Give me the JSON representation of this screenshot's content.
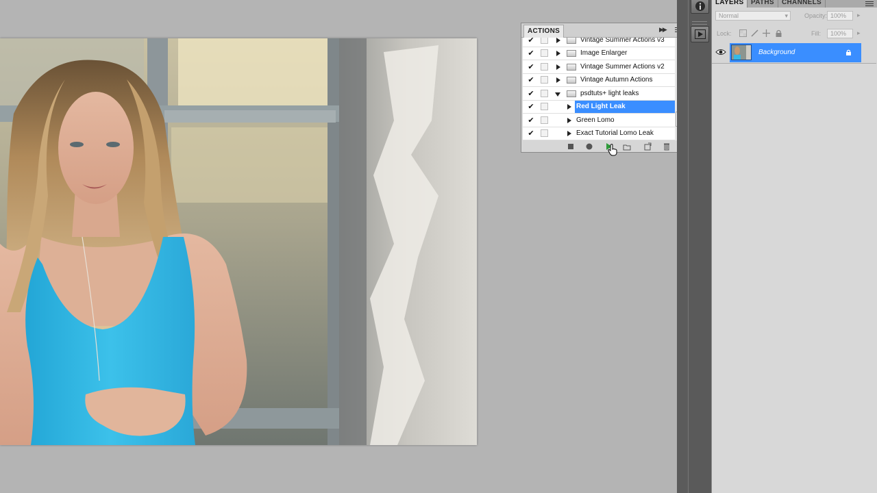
{
  "colors": {
    "workspace": "#b4b4b4",
    "selection": "#3a8eff",
    "dock": "#5a5a5a",
    "panel": "#d6d6d6",
    "tank_top": "#36b9e5"
  },
  "actions_panel": {
    "tab_label": "ACTIONS",
    "rows": [
      {
        "label": "Vintage Summer Actions v3",
        "checked": true,
        "kind": "set",
        "expanded": false
      },
      {
        "label": "Image Enlarger",
        "checked": true,
        "kind": "set",
        "expanded": false
      },
      {
        "label": "Vintage Summer Actions v2",
        "checked": true,
        "kind": "set",
        "expanded": false
      },
      {
        "label": "Vintage Autumn Actions",
        "checked": true,
        "kind": "set",
        "expanded": false
      },
      {
        "label": "psdtuts+ light leaks",
        "checked": true,
        "kind": "set",
        "expanded": true
      },
      {
        "label": "Red Light Leak",
        "checked": true,
        "kind": "action",
        "selected": true
      },
      {
        "label": "Green Lomo",
        "checked": true,
        "kind": "action",
        "selected": false
      },
      {
        "label": "Exact Tutorial Lomo Leak",
        "checked": true,
        "kind": "action",
        "selected": false
      }
    ],
    "toolbar_icons": [
      "stop-icon",
      "record-icon",
      "play-icon",
      "new-set-icon",
      "new-action-icon",
      "trash-icon"
    ]
  },
  "dock": {
    "icons": [
      "info-icon",
      "actions-play-icon"
    ]
  },
  "layers_panel": {
    "tabs": [
      "LAYERS",
      "PATHS",
      "CHANNELS"
    ],
    "blend_mode": "Normal",
    "opacity_label": "Opacity:",
    "opacity_value": "100%",
    "lock_label": "Lock:",
    "fill_label": "Fill:",
    "fill_value": "100%",
    "layers": [
      {
        "name": "Background",
        "visible": true,
        "locked": true,
        "selected": true
      }
    ]
  }
}
